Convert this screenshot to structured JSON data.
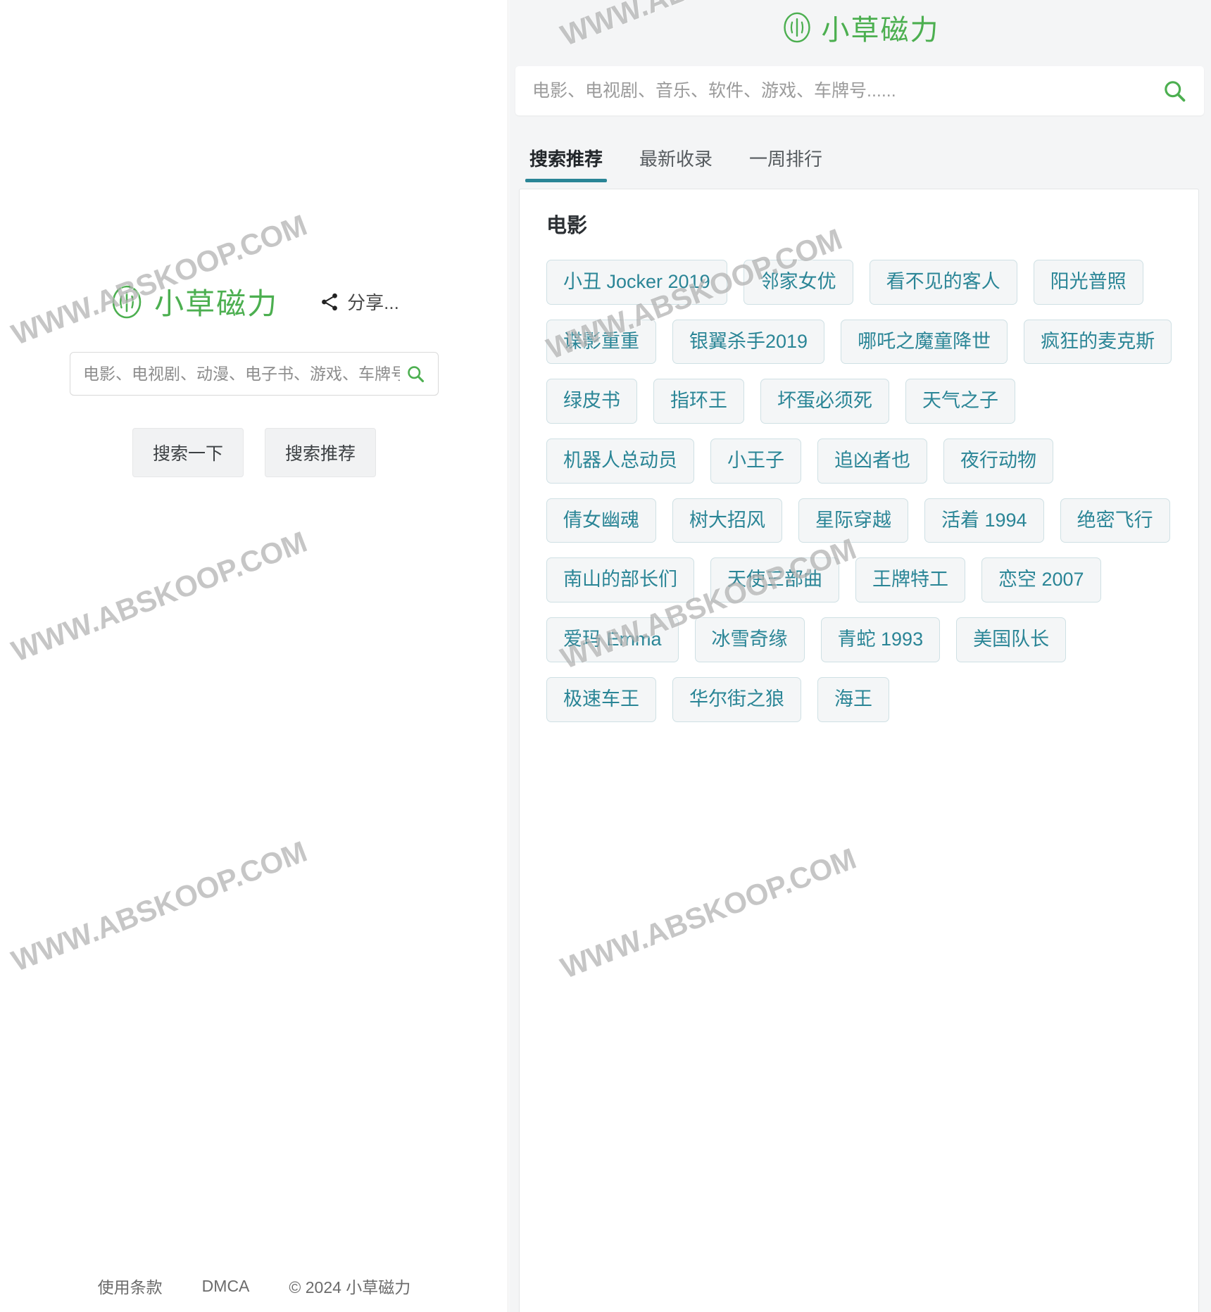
{
  "brand": {
    "name": "小草磁力",
    "logo_color": "#4caf50",
    "mark_icon": "grass-leaf-logo-icon"
  },
  "left": {
    "share": {
      "label": "分享...",
      "icon": "share-icon"
    },
    "search": {
      "placeholder": "电影、电视剧、动漫、电子书、游戏、车牌号......",
      "value": "",
      "button_icon": "search-icon"
    },
    "buttons": [
      {
        "label": "搜索一下",
        "name": "search-submit-button"
      },
      {
        "label": "搜索推荐",
        "name": "search-suggest-button"
      }
    ],
    "footer": {
      "terms": "使用条款",
      "dmca": "DMCA",
      "copyright": "© 2024 小草磁力"
    }
  },
  "right": {
    "search": {
      "placeholder": "电影、电视剧、音乐、软件、游戏、车牌号......",
      "value": "",
      "button_icon": "search-icon"
    },
    "tabs": [
      {
        "label": "搜索推荐",
        "active": true
      },
      {
        "label": "最新收录",
        "active": false
      },
      {
        "label": "一周排行",
        "active": false
      }
    ],
    "active_tab_color": "#2a8596",
    "section": {
      "title": "电影",
      "tags": [
        "小丑 Jocker 2019",
        "邻家女优",
        "看不见的客人",
        "阳光普照",
        "谍影重重",
        "银翼杀手2019",
        "哪吒之魔童降世",
        "疯狂的麦克斯",
        "绿皮书",
        "指环王",
        "坏蛋必须死",
        "天气之子",
        "机器人总动员",
        "小王子",
        "追凶者也",
        "夜行动物",
        "倩女幽魂",
        "树大招风",
        "星际穿越",
        "活着 1994",
        "绝密飞行",
        "南山的部长们",
        "天使三部曲",
        "王牌特工",
        "恋空 2007",
        "爱玛 Emma",
        "冰雪奇缘",
        "青蛇 1993",
        "美国队长",
        "极速车王",
        "华尔街之狼",
        "海王"
      ]
    }
  },
  "watermark": {
    "text": "WWW.ABSKOOP.COM"
  }
}
